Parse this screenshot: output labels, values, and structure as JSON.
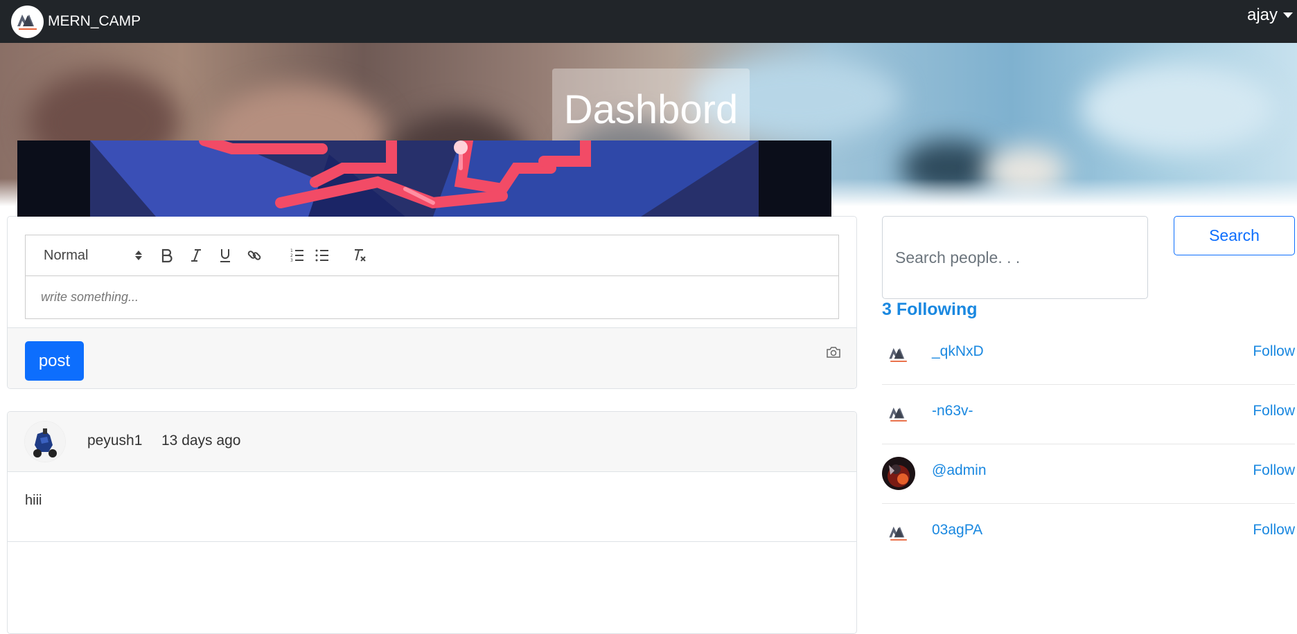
{
  "navbar": {
    "brand": "MERN_CAMP",
    "logo_icon": "mern-camp-logo-icon",
    "user": "ajay"
  },
  "hero": {
    "title": "Dashbord"
  },
  "editor": {
    "format_select": "Normal",
    "toolbar_icons": [
      "bold-icon",
      "italic-icon",
      "underline-icon",
      "link-icon",
      "ordered-list-icon",
      "bullet-list-icon",
      "clear-format-icon"
    ],
    "placeholder": "write something...",
    "post_button": "post",
    "upload_icon": "camera-icon"
  },
  "posts": [
    {
      "user": "peyush1",
      "time": "13 days ago",
      "text": "hiii"
    }
  ],
  "search": {
    "placeholder": "Search people. . .",
    "button": "Search"
  },
  "following": {
    "title": "3 Following",
    "people": [
      {
        "name": "_qkNxD",
        "action": "Follow"
      },
      {
        "name": "-n63v-",
        "action": "Follow"
      },
      {
        "name": "@admin",
        "action": "Follow"
      },
      {
        "name": "03agPA",
        "action": "Follow"
      }
    ]
  },
  "colors": {
    "navbar_bg": "#212529",
    "primary": "#0d6efd",
    "link": "#1a88e0"
  }
}
